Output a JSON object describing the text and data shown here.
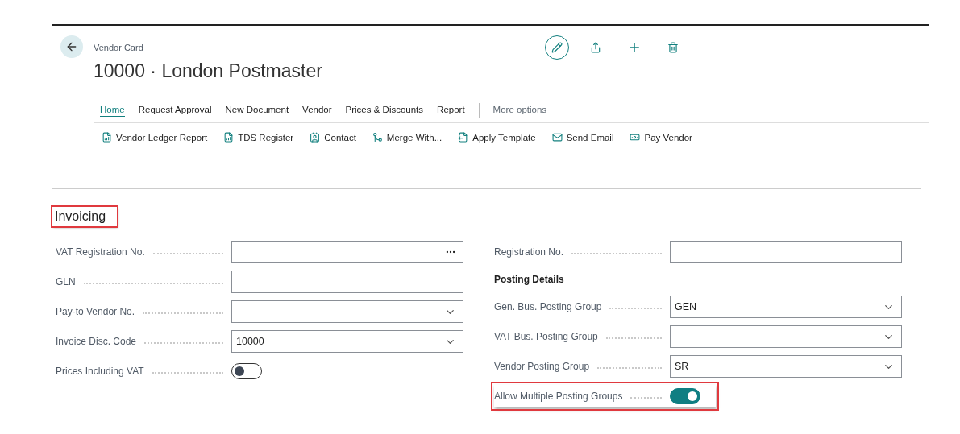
{
  "header": {
    "breadcrumb": "Vendor Card",
    "title": "10000 · London Postmaster"
  },
  "tabs": [
    {
      "label": "Home",
      "selected": true
    },
    {
      "label": "Request Approval",
      "selected": false
    },
    {
      "label": "New Document",
      "selected": false
    },
    {
      "label": "Vendor",
      "selected": false
    },
    {
      "label": "Prices & Discounts",
      "selected": false
    },
    {
      "label": "Report",
      "selected": false
    }
  ],
  "more_options": "More options",
  "actions": [
    {
      "label": "Vendor Ledger Report",
      "kind": "report"
    },
    {
      "label": "TDS Register",
      "kind": "report"
    },
    {
      "label": "Contact",
      "kind": "contact"
    },
    {
      "label": "Merge With...",
      "kind": "merge"
    },
    {
      "label": "Apply Template",
      "kind": "template"
    },
    {
      "label": "Send Email",
      "kind": "email"
    },
    {
      "label": "Pay Vendor",
      "kind": "pay"
    }
  ],
  "section": {
    "title": "Invoicing",
    "highlighted": true
  },
  "left_fields": [
    {
      "kind": "assist",
      "label": "VAT Registration No."
    },
    {
      "kind": "text",
      "label": "GLN"
    },
    {
      "kind": "select",
      "label": "Pay-to Vendor No."
    },
    {
      "kind": "select",
      "label": "Invoice Disc. Code",
      "value": "10000"
    },
    {
      "kind": "toggle",
      "label": "Prices Including VAT",
      "on": false,
      "highlighted": false
    }
  ],
  "right_fields": [
    {
      "kind": "text",
      "label": "Registration No."
    },
    {
      "kind": "heading",
      "label": "Posting Details"
    },
    {
      "kind": "select",
      "label": "Gen. Bus. Posting Group",
      "value": "GEN"
    },
    {
      "kind": "select",
      "label": "VAT Bus. Posting Group"
    },
    {
      "kind": "select",
      "label": "Vendor Posting Group",
      "value": "SR"
    },
    {
      "kind": "toggle",
      "label": "Allow Multiple Posting Groups",
      "on": true,
      "highlighted": true
    }
  ]
}
